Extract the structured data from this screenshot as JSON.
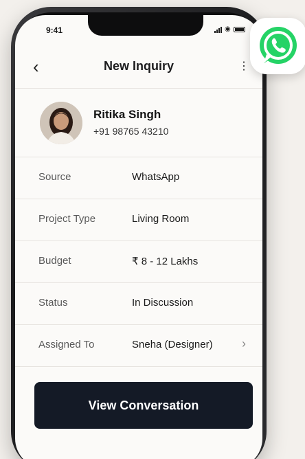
{
  "status_bar": {
    "time": "9:41"
  },
  "header": {
    "title": "New Inquiry"
  },
  "contact": {
    "name": "Ritika Singh",
    "phone": "+91 98765 43210"
  },
  "details": [
    {
      "label": "Source",
      "value": "WhatsApp"
    },
    {
      "label": "Project Type",
      "value": "Living Room"
    },
    {
      "label": "Budget",
      "value": "₹ 8 - 12 Lakhs"
    },
    {
      "label": "Status",
      "value": "In Discussion"
    },
    {
      "label": "Assigned To",
      "value": "Sneha (Designer)"
    }
  ],
  "cta": {
    "label": "View Conversation"
  },
  "icons": {
    "back": "back-arrow-icon",
    "more": "more-icon",
    "chevron": "chevron-right-icon",
    "whatsapp": "whatsapp-icon"
  },
  "colors": {
    "button": "#141a26",
    "whatsapp_green": "#25d366",
    "background": "#f3f0ec"
  }
}
